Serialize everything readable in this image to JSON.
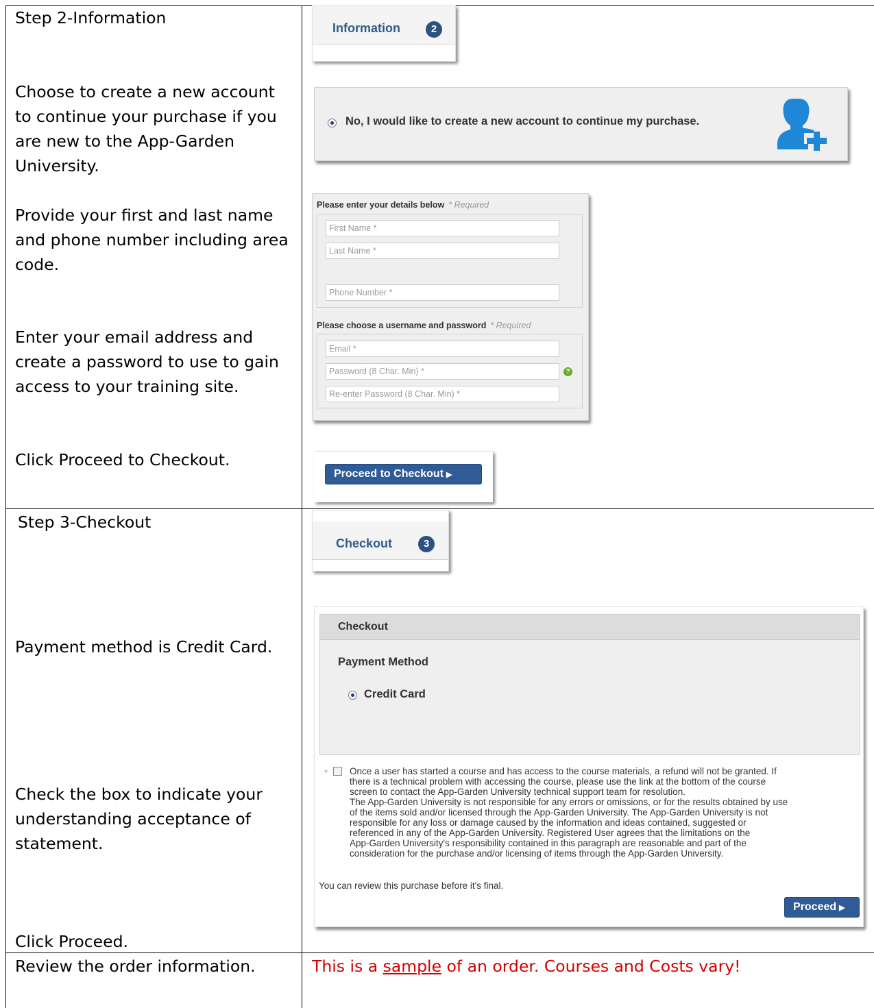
{
  "rows": {
    "step2_heading": "Step 2-Information",
    "create_account_instruction": "Choose to create a new account to continue your purchase if you are new to the App-Garden University.",
    "name_phone_instruction": "Provide your first and last name and phone number including area code.",
    "email_password_instruction": "Enter your email address and create a password to use to gain access to your training site.",
    "proceed_checkout_instruction": "Click Proceed to Checkout.",
    "step3_heading": "Step 3-Checkout",
    "payment_instruction": "Payment method is Credit Card.",
    "checkbox_instruction": "Check the box to indicate your understanding acceptance of statement.",
    "proceed_instruction": "Click Proceed.",
    "review_instruction": "Review the order information."
  },
  "information_tab": {
    "label": "Information",
    "badge": "2"
  },
  "new_account_option": {
    "label": "No, I would like to create a new account to continue my purchase."
  },
  "details_form": {
    "title": "Please enter your details below",
    "required_note": "* Required",
    "first_name_placeholder": "First Name *",
    "last_name_placeholder": "Last Name *",
    "phone_placeholder": "Phone Number *"
  },
  "credentials_form": {
    "title": "Please choose a username and password",
    "required_note": "* Required",
    "email_placeholder": "Email *",
    "password_placeholder": "Password (8 Char. Min) *",
    "reenter_password_placeholder": "Re-enter Password (8 Char. Min) *"
  },
  "proceed_to_checkout_button": "Proceed to Checkout",
  "checkout_tab": {
    "label": "Checkout",
    "badge": "3"
  },
  "checkout_panel": {
    "title": "Checkout",
    "payment_method_label": "Payment Method",
    "credit_card_label": "Credit Card",
    "asterisk": "*",
    "terms_lines": [
      "Once a user has started a course and has access to the course materials, a refund will not be granted. If",
      "there is a technical problem with accessing the course, please use the link at the bottom of the course",
      "screen to contact the App-Garden University technical support team for resolution.",
      "The App-Garden University is not responsible for any errors or omissions, or for the results obtained by use",
      "of the items sold and/or licensed through the App-Garden University. The App-Garden University is not",
      "responsible for any loss or damage caused by the information and ideas contained, suggested or",
      "referenced in any of the App-Garden University. Registered User agrees that the limitations on the",
      "App-Garden University's responsibility contained in this paragraph are reasonable and part of the",
      "consideration for the purchase and/or licensing of items through the App-Garden University."
    ],
    "review_note": "You can review this purchase before it's final.",
    "proceed_button": "Proceed"
  },
  "sample_note": {
    "prefix": "This is a ",
    "underlined": "sample",
    "suffix": " of an order. Courses and Costs vary!",
    "color": "#d40000"
  },
  "colors": {
    "brand_blue": "#2f5b96",
    "icon_blue": "#1e88d6",
    "help_green": "#6aa928"
  }
}
